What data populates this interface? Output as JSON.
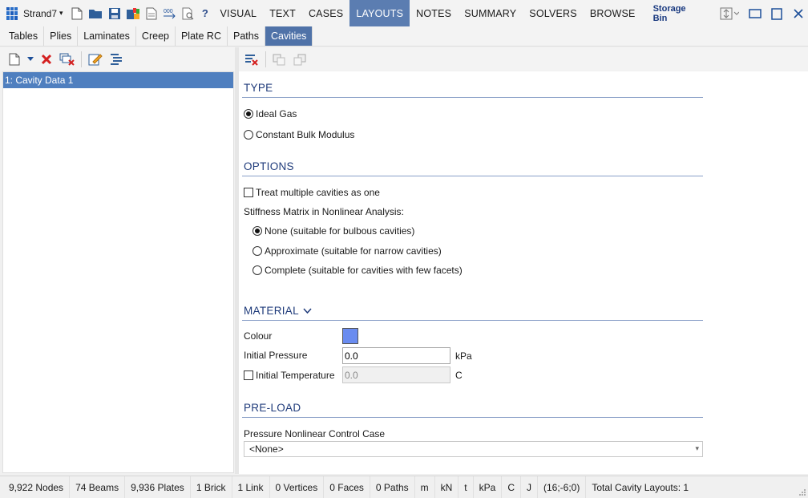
{
  "app": {
    "name": "Strand7"
  },
  "menu_tabs": [
    {
      "label": "VISUAL",
      "active": false
    },
    {
      "label": "TEXT",
      "active": false
    },
    {
      "label": "CASES",
      "active": false
    },
    {
      "label": "LAYOUTS",
      "active": true
    },
    {
      "label": "NOTES",
      "active": false
    },
    {
      "label": "SUMMARY",
      "active": false
    },
    {
      "label": "SOLVERS",
      "active": false
    },
    {
      "label": "BROWSE",
      "active": false
    }
  ],
  "help_label": "?",
  "storage_bin_label": "Storage Bin",
  "sub_tabs": [
    {
      "label": "Tables",
      "active": false
    },
    {
      "label": "Plies",
      "active": false
    },
    {
      "label": "Laminates",
      "active": false
    },
    {
      "label": "Creep",
      "active": false
    },
    {
      "label": "Plate RC",
      "active": false
    },
    {
      "label": "Paths",
      "active": false
    },
    {
      "label": "Cavities",
      "active": true
    }
  ],
  "list_items": [
    "1: Cavity Data 1"
  ],
  "type": {
    "title": "TYPE",
    "options": [
      {
        "label": "Ideal Gas",
        "selected": true
      },
      {
        "label": "Constant Bulk Modulus",
        "selected": false
      }
    ]
  },
  "options": {
    "title": "OPTIONS",
    "treat_multiple": {
      "label": "Treat multiple cavities as one",
      "checked": false
    },
    "stiffness_label": "Stiffness Matrix in Nonlinear Analysis:",
    "stiffness_options": [
      {
        "label": "None (suitable for bulbous cavities)",
        "selected": true
      },
      {
        "label": "Approximate (suitable for narrow cavities)",
        "selected": false
      },
      {
        "label": "Complete (suitable for cavities with few facets)",
        "selected": false
      }
    ]
  },
  "material": {
    "title": "MATERIAL",
    "colour_label": "Colour",
    "colour_value": "#6a8cf0",
    "initial_pressure_label": "Initial Pressure",
    "initial_pressure_value": "0.0",
    "pressure_unit": "kPa",
    "initial_temp_label": "Initial Temperature",
    "initial_temp_checked": false,
    "initial_temp_value": "0.0",
    "temp_unit": "C"
  },
  "preload": {
    "title": "PRE-LOAD",
    "control_case_label": "Pressure Nonlinear Control Case",
    "control_case_value": "<None>"
  },
  "status": [
    "9,922 Nodes",
    "74 Beams",
    "9,936 Plates",
    "1 Brick",
    "1 Link",
    "0 Vertices",
    "0 Faces",
    "0 Paths",
    "m",
    "kN",
    "t",
    "kPa",
    "C",
    "J",
    "(16;-6;0)",
    "Total Cavity Layouts: 1"
  ],
  "colors": {
    "accent": "#4f72a8",
    "selection": "#4f7fbf",
    "section_title": "#1e3a7a"
  }
}
